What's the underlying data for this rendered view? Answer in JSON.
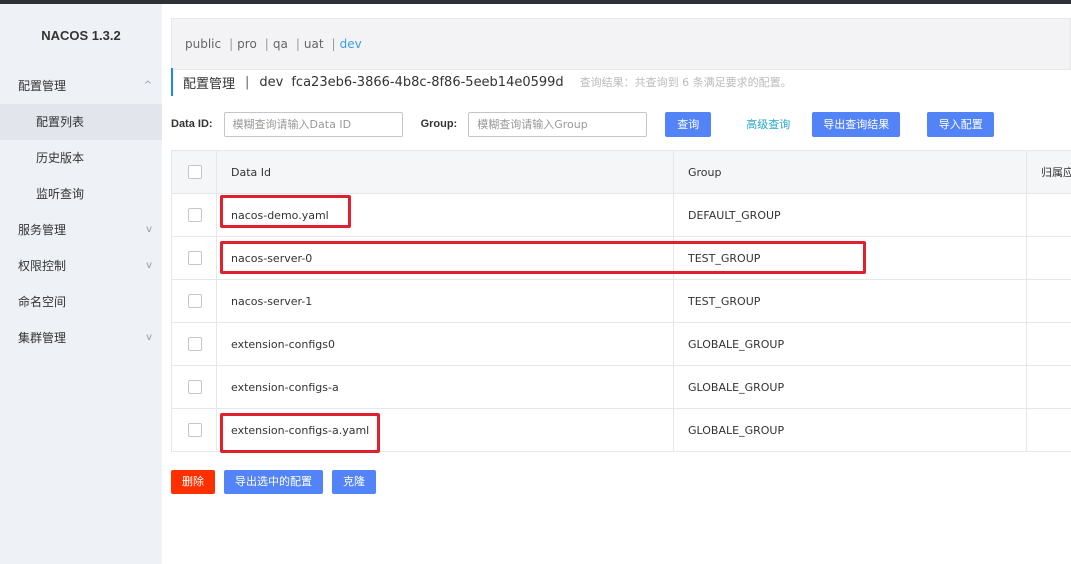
{
  "app": {
    "logo": "NACOS 1.3.2"
  },
  "sidebar": {
    "items": [
      {
        "label": "配置管理",
        "chevron": "^"
      },
      {
        "label": "配置列表"
      },
      {
        "label": "历史版本"
      },
      {
        "label": "监听查询"
      },
      {
        "label": "服务管理",
        "chevron": "v"
      },
      {
        "label": "权限控制",
        "chevron": "v"
      },
      {
        "label": "命名空间"
      },
      {
        "label": "集群管理",
        "chevron": "v"
      }
    ]
  },
  "namespaces": [
    {
      "label": "public"
    },
    {
      "label": "pro"
    },
    {
      "label": "qa"
    },
    {
      "label": "uat"
    },
    {
      "label": "dev"
    }
  ],
  "title": {
    "section": "配置管理",
    "separator": "|",
    "namespace_name": "dev",
    "namespace_id": "fca23eb6-3866-4b8c-8f86-5eeb14e0599d",
    "result_text": "查询结果：共查询到 6 条满足要求的配置。"
  },
  "search": {
    "data_id_label": "Data ID:",
    "data_id_placeholder": "模糊查询请输入Data ID",
    "group_label": "Group:",
    "group_placeholder": "模糊查询请输入Group",
    "query_button": "查询",
    "advanced_link": "高级查询",
    "export_results_button": "导出查询结果",
    "import_button": "导入配置"
  },
  "table": {
    "headers": {
      "data_id": "Data Id",
      "group": "Group",
      "app": "归属应"
    },
    "rows": [
      {
        "data_id": "nacos-demo.yaml",
        "group": "DEFAULT_GROUP"
      },
      {
        "data_id": "nacos-server-0",
        "group": "TEST_GROUP"
      },
      {
        "data_id": "nacos-server-1",
        "group": "TEST_GROUP"
      },
      {
        "data_id": "extension-configs0",
        "group": "GLOBALE_GROUP"
      },
      {
        "data_id": "extension-configs-a",
        "group": "GLOBALE_GROUP"
      },
      {
        "data_id": "extension-configs-a.yaml",
        "group": "GLOBALE_GROUP"
      }
    ]
  },
  "actions": {
    "delete_button": "删除",
    "export_selected_button": "导出选中的配置",
    "clone_button": "克隆"
  },
  "colors": {
    "primary": "#5384f7",
    "danger": "#ff3000",
    "highlight": "#e0202e",
    "active_namespace": "#3aa0e6",
    "link": "#26a6cc"
  }
}
